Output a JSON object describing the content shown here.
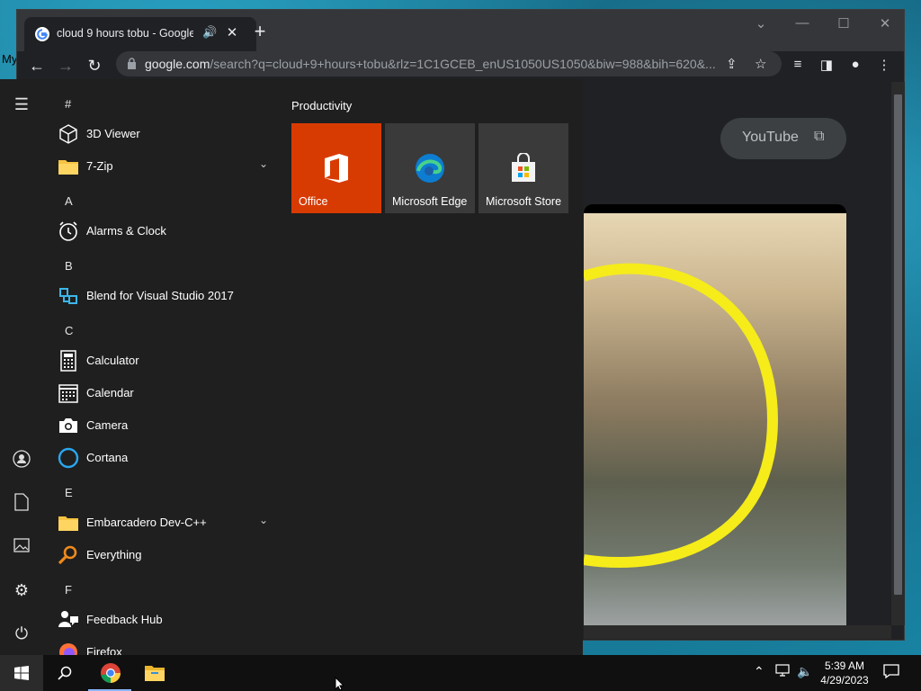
{
  "desktop": {
    "corner_text": "My"
  },
  "browser": {
    "tab_title": "cloud 9 hours tobu - Google",
    "url_domain": "google.com",
    "url_path": "/search?q=cloud+9+hours+tobu&rlz=1C1GCEB_enUS1050US1050&biw=988&bih=620&...",
    "page": {
      "youtube_button": "YouTube"
    }
  },
  "start_menu": {
    "sections": [
      {
        "letter": "#",
        "apps": [
          {
            "name": "3D Viewer",
            "icon": "cube-icon"
          },
          {
            "name": "7-Zip",
            "icon": "folder-icon",
            "expandable": true
          }
        ]
      },
      {
        "letter": "A",
        "apps": [
          {
            "name": "Alarms & Clock",
            "icon": "alarm-clock-icon"
          }
        ]
      },
      {
        "letter": "B",
        "apps": [
          {
            "name": "Blend for Visual Studio 2017",
            "icon": "blend-icon"
          }
        ]
      },
      {
        "letter": "C",
        "apps": [
          {
            "name": "Calculator",
            "icon": "calculator-icon"
          },
          {
            "name": "Calendar",
            "icon": "calendar-icon"
          },
          {
            "name": "Camera",
            "icon": "camera-icon"
          },
          {
            "name": "Cortana",
            "icon": "cortana-icon"
          }
        ]
      },
      {
        "letter": "E",
        "apps": [
          {
            "name": "Embarcadero Dev-C++",
            "icon": "folder-icon",
            "expandable": true
          },
          {
            "name": "Everything",
            "icon": "magnifier-icon"
          }
        ]
      },
      {
        "letter": "F",
        "apps": [
          {
            "name": "Feedback Hub",
            "icon": "feedback-icon"
          },
          {
            "name": "Firefox",
            "icon": "firefox-icon"
          }
        ]
      }
    ],
    "group_title": "Productivity",
    "tiles": [
      {
        "label": "Office",
        "icon": "office-icon",
        "color": "#d83b01"
      },
      {
        "label": "Microsoft Edge",
        "icon": "edge-icon",
        "color": "#3a3a3a"
      },
      {
        "label": "Microsoft Store",
        "icon": "store-icon",
        "color": "#3a3a3a"
      }
    ]
  },
  "taskbar": {
    "time": "5:39 AM",
    "date": "4/29/2023",
    "pinned": [
      "chrome-icon",
      "file-explorer-icon"
    ]
  }
}
